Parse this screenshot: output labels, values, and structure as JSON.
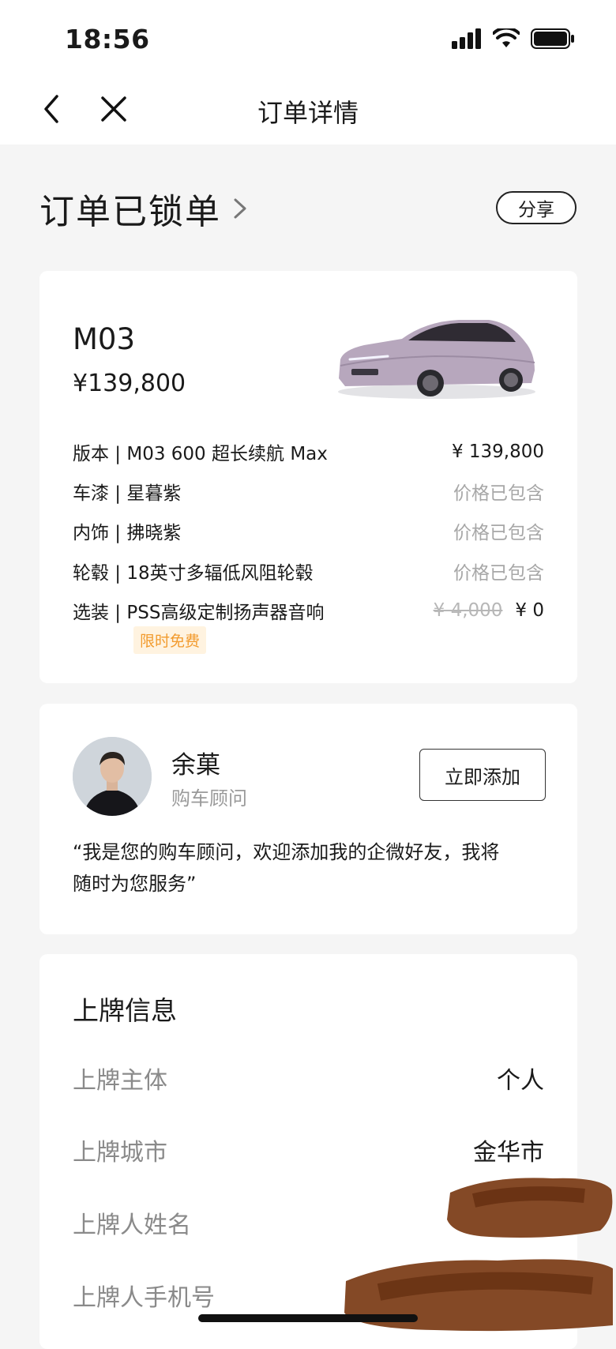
{
  "status_bar": {
    "time": "18:56"
  },
  "nav": {
    "title": "订单详情"
  },
  "order": {
    "status": "订单已锁单",
    "share_label": "分享"
  },
  "car": {
    "model": "M03",
    "price": "¥139,800",
    "specs": [
      {
        "label": "版本 | M03 600 超长续航 Max",
        "value": "¥ 139,800",
        "muted": false
      },
      {
        "label": "车漆 | 星暮紫",
        "value": "价格已包含",
        "muted": true
      },
      {
        "label": "内饰 | 拂晓紫",
        "value": "价格已包含",
        "muted": true
      },
      {
        "label": "轮毂 | 18英寸多辐低风阻轮毂",
        "value": "价格已包含",
        "muted": true
      },
      {
        "label": "选装 | PSS高级定制扬声器音响",
        "original_value": "¥ 4,000",
        "value": "¥ 0",
        "muted": false
      }
    ],
    "promo_badge": "限时免费"
  },
  "advisor": {
    "name": "余菓",
    "role": "购车顾问",
    "add_label": "立即添加",
    "quote_line1": "“我是您的购车顾问，欢迎添加我的企微好友，我将",
    "quote_line2": "随时为您服务”"
  },
  "plate_info": {
    "title": "上牌信息",
    "rows": [
      {
        "label": "上牌主体",
        "value": "个人"
      },
      {
        "label": "上牌城市",
        "value": "金华市"
      },
      {
        "label": "上牌人姓名",
        "value": ""
      },
      {
        "label": "上牌人手机号",
        "value": ""
      }
    ]
  },
  "colors": {
    "accent_badge": "#f29b2e",
    "muted_text": "#a7a7a7",
    "redaction": "#7a3a14"
  }
}
